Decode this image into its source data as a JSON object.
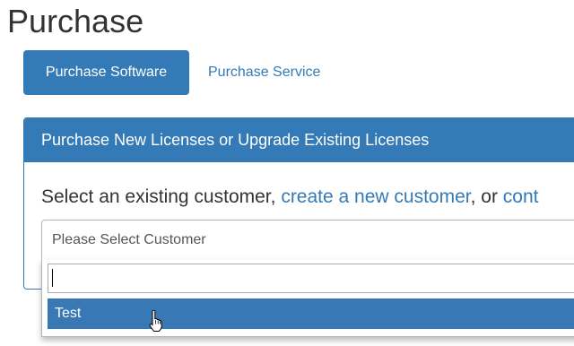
{
  "page": {
    "title": "Purchase"
  },
  "tabs": [
    {
      "label": "Purchase Software",
      "active": true
    },
    {
      "label": "Purchase Service",
      "active": false
    }
  ],
  "panel": {
    "heading": "Purchase New Licenses or Upgrade Existing Licenses",
    "text_prefix": "Select an existing customer, ",
    "link_create": "create a new customer",
    "text_middle": ", or ",
    "link_partial": "cont"
  },
  "customer_select": {
    "placeholder": "Please Select Customer",
    "search_value": "",
    "options": [
      {
        "label": "Test",
        "highlighted": true
      }
    ]
  },
  "colors": {
    "primary": "#337ab7",
    "highlight": "#3879b5",
    "text": "#333333"
  },
  "icons": {
    "cursor": "hand-pointer-icon"
  }
}
